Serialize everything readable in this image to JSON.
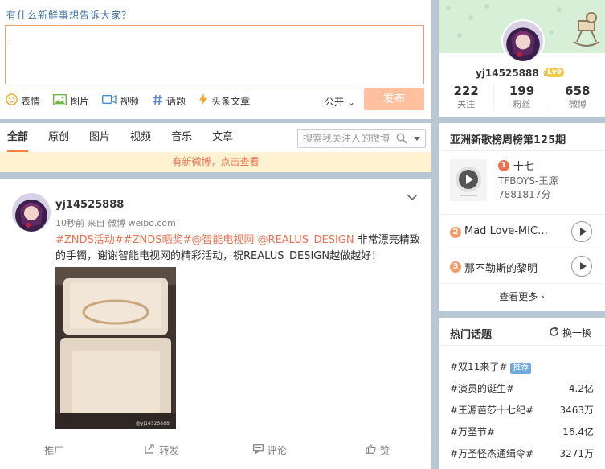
{
  "publisher": {
    "prompt": "有什么新鲜事想告诉大家？",
    "tools": [
      {
        "icon": "smile-icon",
        "label": "表情"
      },
      {
        "icon": "picture-icon",
        "label": "图片"
      },
      {
        "icon": "video-icon",
        "label": "视频"
      },
      {
        "icon": "hashtag-icon",
        "label": "话题"
      },
      {
        "icon": "lightning-icon",
        "label": "头条文章"
      }
    ],
    "scope": "公开",
    "send_label": "发布",
    "send_color": "#ffc09f"
  },
  "filter": {
    "tabs": [
      "全部",
      "原创",
      "图片",
      "视频",
      "音乐",
      "文章"
    ],
    "active_tab": "全部",
    "search_placeholder": "搜索我关注人的微博"
  },
  "notice": "有新微博，点击查看",
  "post": {
    "author": "yj14525888",
    "meta": "10秒前 来自 微博 weibo.com",
    "tags": "#ZNDS活动##ZNDS晒奖#@智能电视网   @REALUS_DESIGN",
    "text_rest": " 非常漂亮精致",
    "text_line2": "的手镯，谢谢智能电视网的精彩活动，祝REALUS_DESIGN越做越好！",
    "actions": [
      {
        "icon": "",
        "label": "推广"
      },
      {
        "icon": "share-icon",
        "label": "转发"
      },
      {
        "icon": "comment-icon",
        "label": "评论"
      },
      {
        "icon": "like-icon",
        "label": "赞"
      }
    ]
  },
  "profile": {
    "name": "yj14525888",
    "level": "Lv9",
    "stats": [
      {
        "num": "222",
        "label": "关注"
      },
      {
        "num": "199",
        "label": "粉丝"
      },
      {
        "num": "658",
        "label": "微博"
      }
    ]
  },
  "music": {
    "title": "亚洲新歌榜周榜第125期",
    "top": {
      "rank": "1",
      "song": "十七",
      "artist": "TFBOYS-王源",
      "score": "7881817分"
    },
    "rows": [
      {
        "rank": "2",
        "song": "Mad Love-MIC…"
      },
      {
        "rank": "3",
        "song": "那不勒斯的黎明"
      }
    ],
    "more": "查看更多 ›",
    "rank_color": "#eb7350"
  },
  "topics": {
    "title": "热门话题",
    "refresh": "换一换",
    "items": [
      {
        "name": "#双11来了#",
        "badge": "推荐",
        "value": ""
      },
      {
        "name": "#演员的诞生#",
        "badge": "",
        "value": "4.2亿"
      },
      {
        "name": "#王源芭莎十七纪#",
        "badge": "",
        "value": "3463万"
      },
      {
        "name": "#万圣节#",
        "badge": "",
        "value": "16.4亿"
      },
      {
        "name": "#万圣怪杰通缉令#",
        "badge": "",
        "value": "3271万"
      }
    ]
  }
}
